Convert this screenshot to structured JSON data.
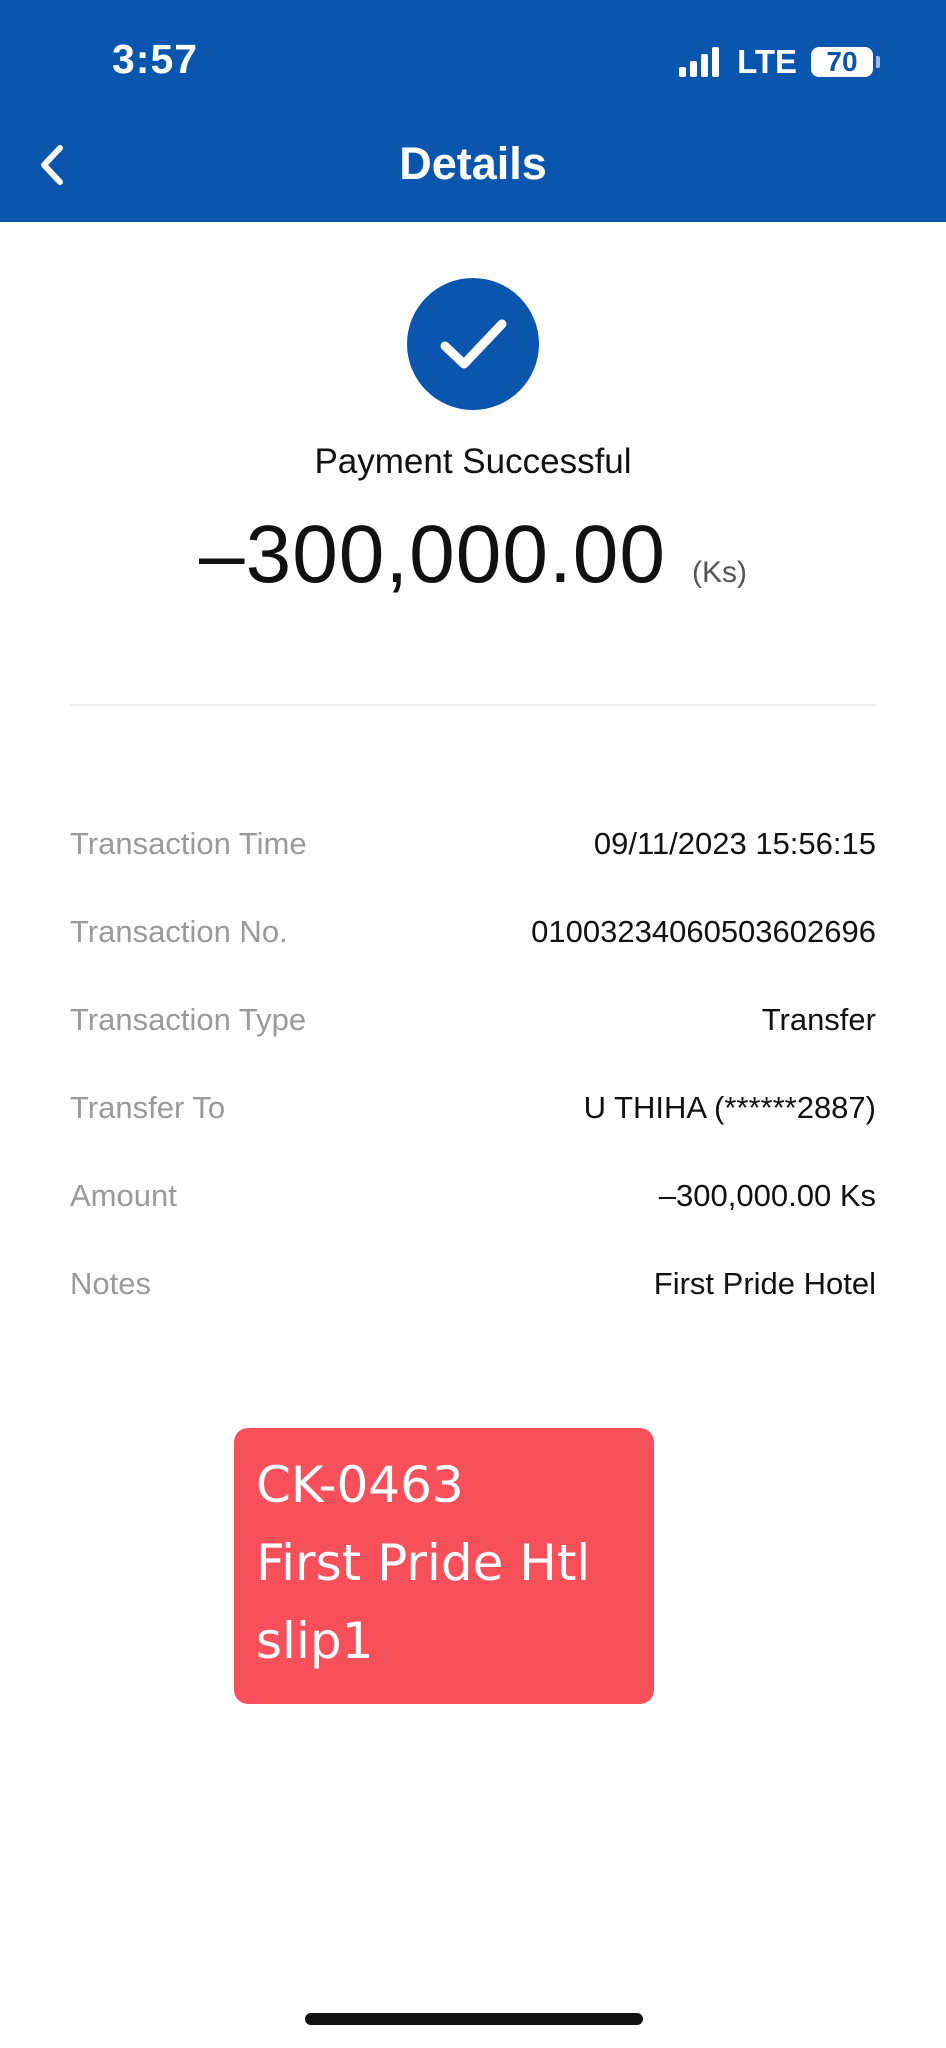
{
  "status_bar": {
    "time": "3:57",
    "network": "LTE",
    "battery": "70",
    "icons": [
      "cellular-signal-icon",
      "battery-icon"
    ]
  },
  "header": {
    "title": "Details",
    "back_icon": "chevron-left-icon",
    "background_color": "#0a55ad"
  },
  "result": {
    "icon": "check-circle-icon",
    "status": "Payment Successful",
    "amount": "–300,000.00",
    "currency": "(Ks)"
  },
  "details": [
    {
      "label": "Transaction Time",
      "value": "09/11/2023 15:56:15"
    },
    {
      "label": "Transaction No.",
      "value": "01003234060503602696"
    },
    {
      "label": "Transaction Type",
      "value": "Transfer"
    },
    {
      "label": "Transfer To",
      "value": "U THIHA (******2887)"
    },
    {
      "label": "Amount",
      "value": "–300,000.00 Ks"
    },
    {
      "label": "Notes",
      "value": "First Pride Hotel"
    }
  ],
  "note_sticker": {
    "lines": [
      "CK-0463",
      "First Pride Htl",
      "slip1"
    ],
    "color": "#f7505a"
  }
}
